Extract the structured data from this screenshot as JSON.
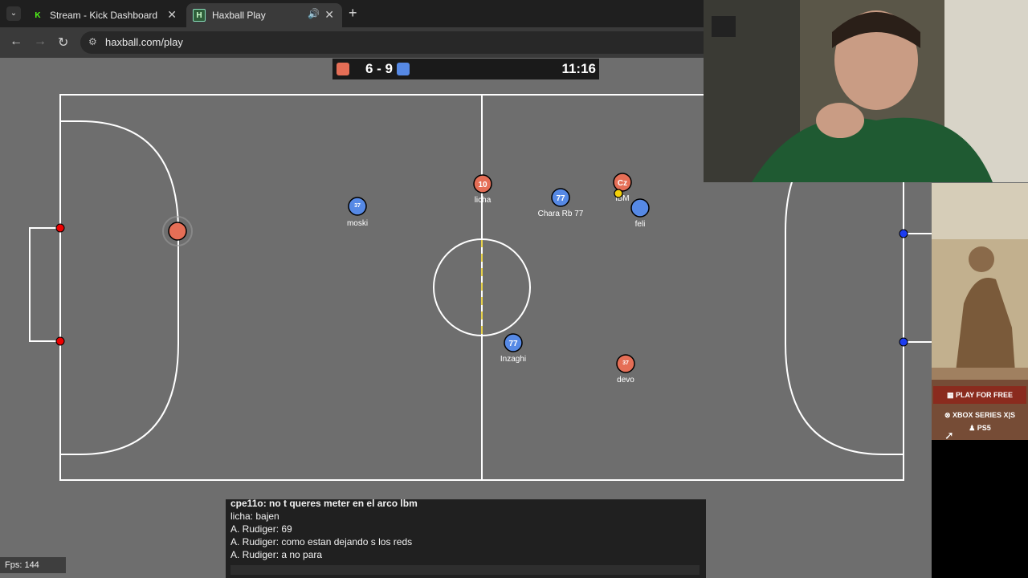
{
  "browser": {
    "tabs": [
      {
        "title": "Stream - Kick Dashboard",
        "favicon": "kick-k-icon",
        "active": false
      },
      {
        "title": "Haxball Play",
        "favicon": "haxball-icon",
        "active": true,
        "audio": true
      }
    ],
    "url": "haxball.com/play"
  },
  "game": {
    "score": "6 - 9",
    "timer": "11:16",
    "colors": {
      "red": "#e56e56",
      "blue": "#5689e5",
      "pitch": "#6e6e6e",
      "line": "#ffffff"
    },
    "players": [
      {
        "name": "moski",
        "number": "37",
        "team": "blue"
      },
      {
        "name": "licha",
        "number": "10",
        "team": "red"
      },
      {
        "name": "Chara Rb 77",
        "number": "77",
        "team": "blue"
      },
      {
        "name": "lBM",
        "number": "Cz",
        "team": "red"
      },
      {
        "name": "feli",
        "number": "",
        "team": "blue"
      },
      {
        "name": "Inzaghi",
        "number": "77",
        "team": "blue"
      },
      {
        "name": "devo",
        "number": "37",
        "team": "red"
      },
      {
        "name": "",
        "number": "",
        "team": "red",
        "role": "goalkeeper"
      }
    ],
    "fps": "Fps: 144"
  },
  "chat": {
    "lines": [
      "cpe11o: no t queres meter en el arco lbm",
      "licha: bajen",
      "A. Rudiger: 69",
      "A. Rudiger: como estan dejando s los reds",
      "A. Rudiger: a no para"
    ]
  },
  "ad": {
    "cta": "PLAY FOR FREE",
    "platform1": "XBOX SERIES X|S",
    "platform2": "PS5"
  }
}
